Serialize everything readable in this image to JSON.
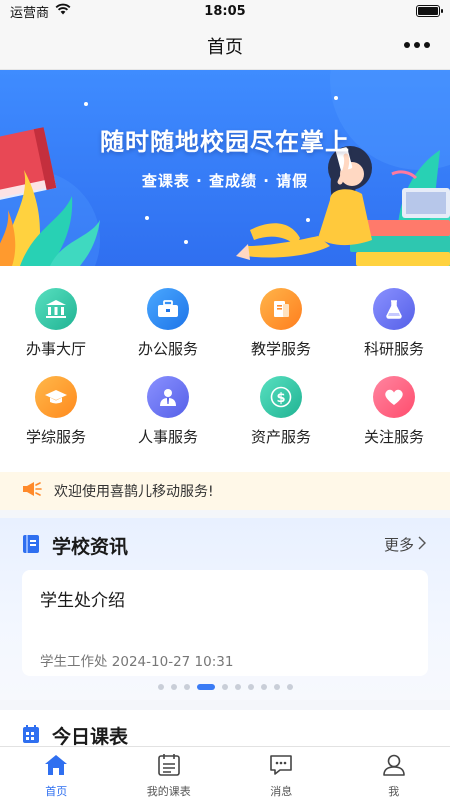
{
  "status_bar": {
    "carrier": "运营商",
    "time": "18:05"
  },
  "nav": {
    "title": "首页"
  },
  "banner": {
    "title": "随时随地校园尽在掌上",
    "subtitle": "查课表 · 查成绩 · 请假"
  },
  "services": [
    {
      "label": "办事大厅",
      "icon": "bank-icon",
      "color": "#36c6a6"
    },
    {
      "label": "办公服务",
      "icon": "briefcase-icon",
      "color": "#2f8cf5"
    },
    {
      "label": "教学服务",
      "icon": "book-icon",
      "color": "#ff9a2e"
    },
    {
      "label": "科研服务",
      "icon": "flask-icon",
      "color": "#6b73f0"
    },
    {
      "label": "学综服务",
      "icon": "graduation-cap-icon",
      "color": "#ff9f2e"
    },
    {
      "label": "人事服务",
      "icon": "person-icon",
      "color": "#6b73f0"
    },
    {
      "label": "资产服务",
      "icon": "dollar-icon",
      "color": "#36c6a6"
    },
    {
      "label": "关注服务",
      "icon": "heart-icon",
      "color": "#ff5a7a"
    }
  ],
  "notice": {
    "text": "欢迎使用喜鹊儿移动服务!"
  },
  "news": {
    "title": "学校资讯",
    "more_label": "更多",
    "card": {
      "title": "学生处介绍",
      "meta": "学生工作处  2024-10-27 10:31"
    },
    "page_count": 10,
    "active_page": 3
  },
  "today": {
    "title": "今日课表"
  },
  "tabbar": [
    {
      "label": "首页",
      "icon": "home-icon",
      "active": true
    },
    {
      "label": "我的课表",
      "icon": "calendar-icon",
      "active": false
    },
    {
      "label": "消息",
      "icon": "message-icon",
      "active": false
    },
    {
      "label": "我",
      "icon": "user-icon",
      "active": false
    }
  ],
  "colors": {
    "accent": "#2f6ff0",
    "banner": "#3a80fa",
    "notice_bg": "#fff8e8"
  }
}
